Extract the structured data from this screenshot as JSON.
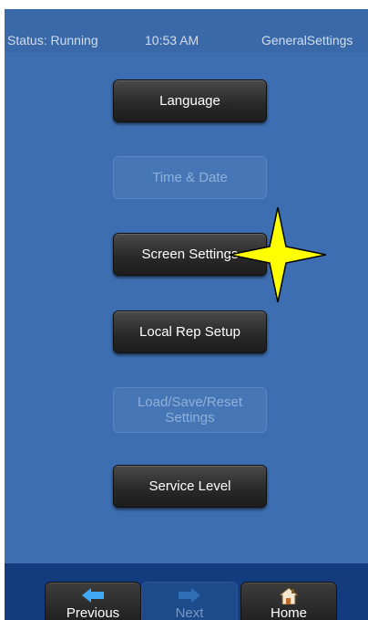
{
  "status_bar": {
    "status": "Status: Running",
    "time": "10:53 AM",
    "screen_name": "GeneralSettings"
  },
  "menu": {
    "language": "Language",
    "time_date": "Time & Date",
    "screen_settings": "Screen Settings",
    "local_rep_setup": "Local Rep Setup",
    "load_save_reset_line1": "Load/Save/Reset",
    "load_save_reset_line2": "Settings",
    "service_level": "Service Level"
  },
  "nav": {
    "previous": "Previous",
    "next": "Next",
    "home": "Home"
  },
  "colors": {
    "background": "#3d6eb1",
    "nav_bar": "#123c7e",
    "button": "#2a2a2a",
    "highlight_star": "#ffff00"
  }
}
